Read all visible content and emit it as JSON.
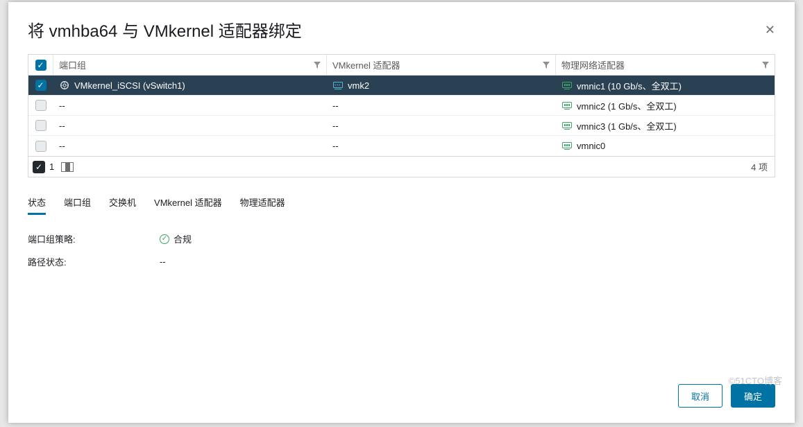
{
  "dialog": {
    "title": "将 vmhba64 与 VMkernel 适配器绑定",
    "close_aria": "关闭"
  },
  "grid": {
    "columns": {
      "port_group": "端口组",
      "vmkernel": "VMkernel 适配器",
      "physical": "物理网络适配器"
    },
    "rows": [
      {
        "checked": true,
        "selected": true,
        "port_group": "VMkernel_iSCSI (vSwitch1)",
        "vmkernel": "vmk2",
        "physical": "vmnic1 (10 Gb/s、全双工)"
      },
      {
        "checked": false,
        "selected": false,
        "port_group": "--",
        "vmkernel": "--",
        "physical": "vmnic2 (1 Gb/s、全双工)"
      },
      {
        "checked": false,
        "selected": false,
        "port_group": "--",
        "vmkernel": "--",
        "physical": "vmnic3 (1 Gb/s、全双工)"
      },
      {
        "checked": false,
        "selected": false,
        "port_group": "--",
        "vmkernel": "--",
        "physical": "vmnic0"
      }
    ],
    "footer": {
      "selected_count": "1",
      "total_label": "4 项"
    }
  },
  "tabs": {
    "items": [
      {
        "label": "状态",
        "active": true
      },
      {
        "label": "端口组",
        "active": false
      },
      {
        "label": "交换机",
        "active": false
      },
      {
        "label": "VMkernel 适配器",
        "active": false
      },
      {
        "label": "物理适配器",
        "active": false
      }
    ]
  },
  "details": {
    "policy_label": "端口组策略:",
    "policy_value": "合规",
    "path_label": "路径状态:",
    "path_value": "--"
  },
  "buttons": {
    "cancel": "取消",
    "ok": "确定"
  },
  "watermark": "©51CTO博客"
}
